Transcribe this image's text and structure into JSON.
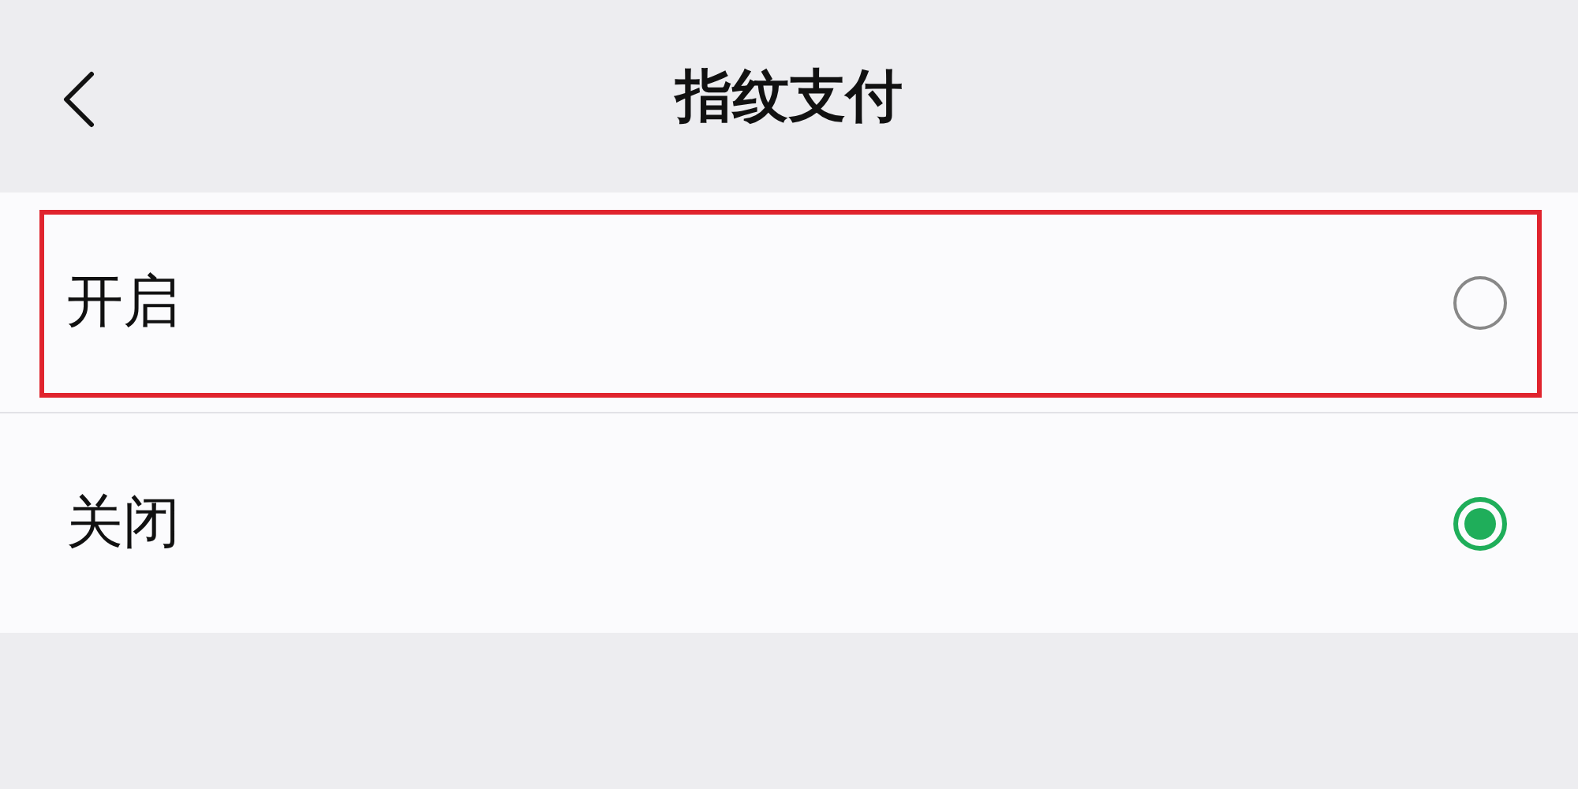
{
  "header": {
    "title": "指纹支付"
  },
  "options": [
    {
      "label": "开启",
      "selected": false,
      "highlighted": true
    },
    {
      "label": "关闭",
      "selected": true,
      "highlighted": false
    }
  ]
}
